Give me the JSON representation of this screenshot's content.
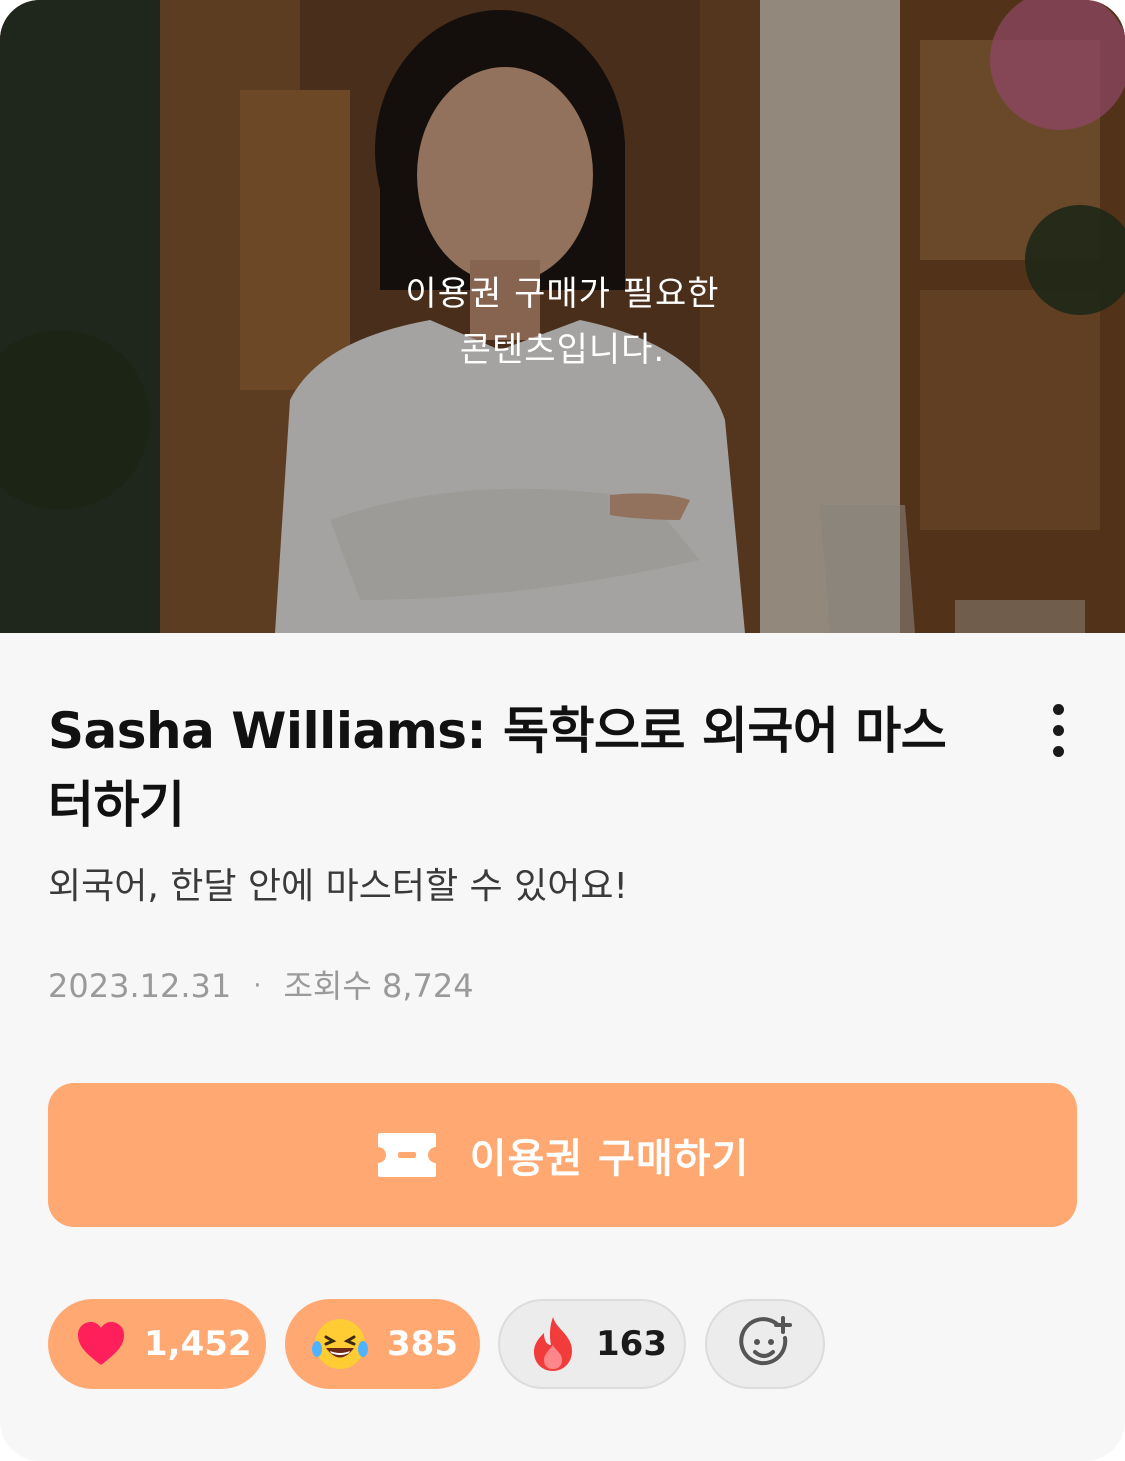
{
  "hero": {
    "message_line1": "이용권 구매가 필요한",
    "message_line2": "콘텐츠입니다.",
    "image": "woman-in-white-shirt-cafe-photo"
  },
  "post": {
    "title": "Sasha Williams: 독학으로 외국어 마스터하기",
    "subtitle": "외국어, 한달 안에 마스터할 수 있어요!",
    "date": "2023.12.31",
    "separator": "·",
    "views_label": "조회수 8,724",
    "more_icon": "more-vertical-icon"
  },
  "buy_button": {
    "label": "이용권 구매하기",
    "icon": "ticket-icon"
  },
  "reactions": [
    {
      "icon": "heart-icon",
      "count": "1,452",
      "active": true
    },
    {
      "icon": "laughing-tears-emoji-icon",
      "count": "385",
      "active": true
    },
    {
      "icon": "fire-icon",
      "count": "163",
      "active": false
    },
    {
      "icon": "add-reaction-icon",
      "count": "",
      "active": false
    }
  ],
  "colors": {
    "accent": "#ffa872",
    "background": "#f7f7f7",
    "text_primary": "#111111",
    "text_secondary": "#3a3a3a",
    "text_muted": "#9a9a9a",
    "heart": "#ff1f5a",
    "fire": "#f23b3b"
  }
}
